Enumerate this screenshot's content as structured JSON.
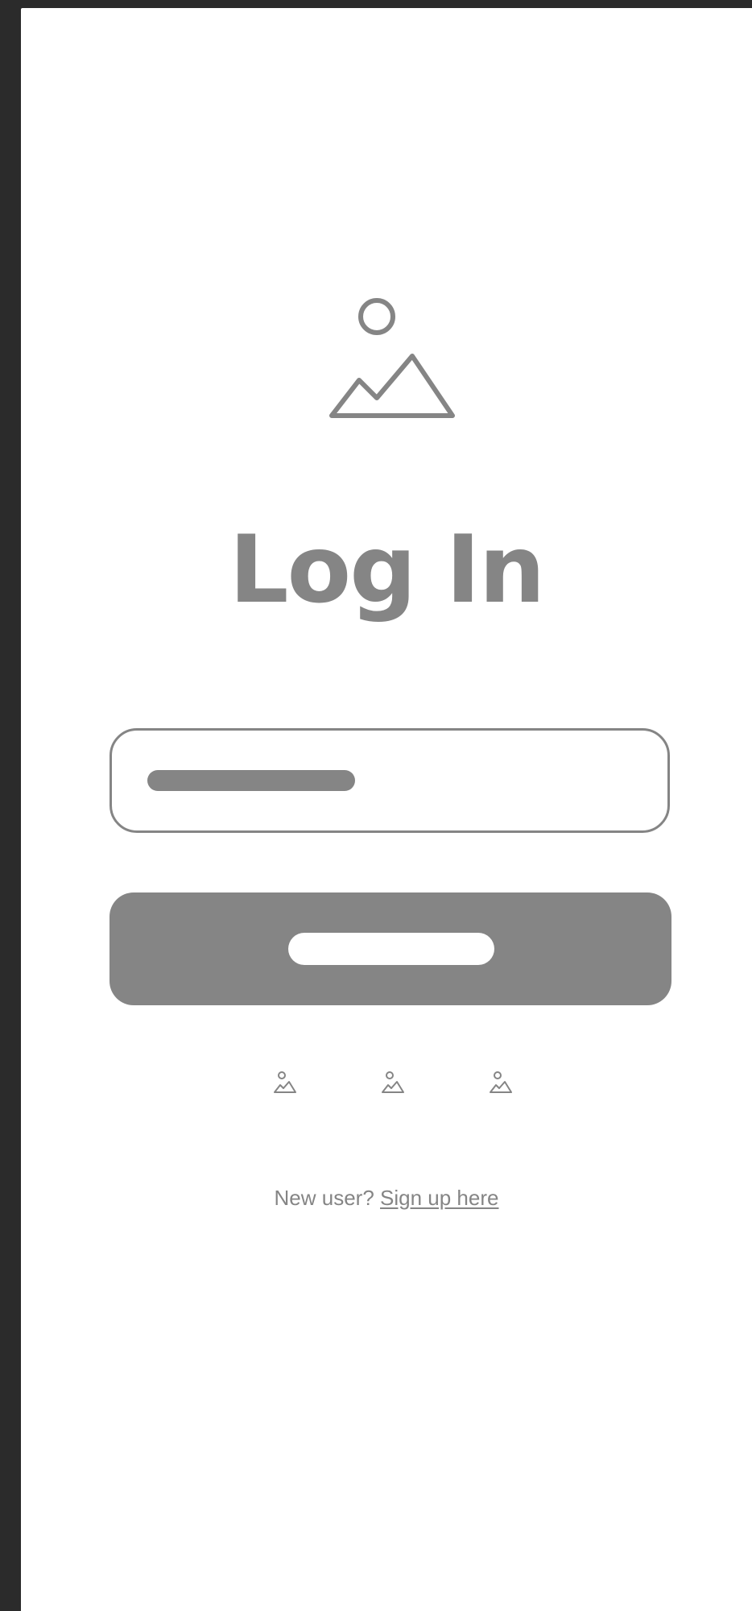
{
  "login": {
    "title": "Log In",
    "signup_prompt": "New user?",
    "signup_link": "Sign up here"
  },
  "icons": {
    "hero": "image-placeholder-icon",
    "social": [
      "image-placeholder-icon",
      "image-placeholder-icon",
      "image-placeholder-icon"
    ]
  },
  "colors": {
    "wireframe_gray": "#858585",
    "frame_background": "#2b2b2b",
    "screen_background": "#ffffff"
  }
}
